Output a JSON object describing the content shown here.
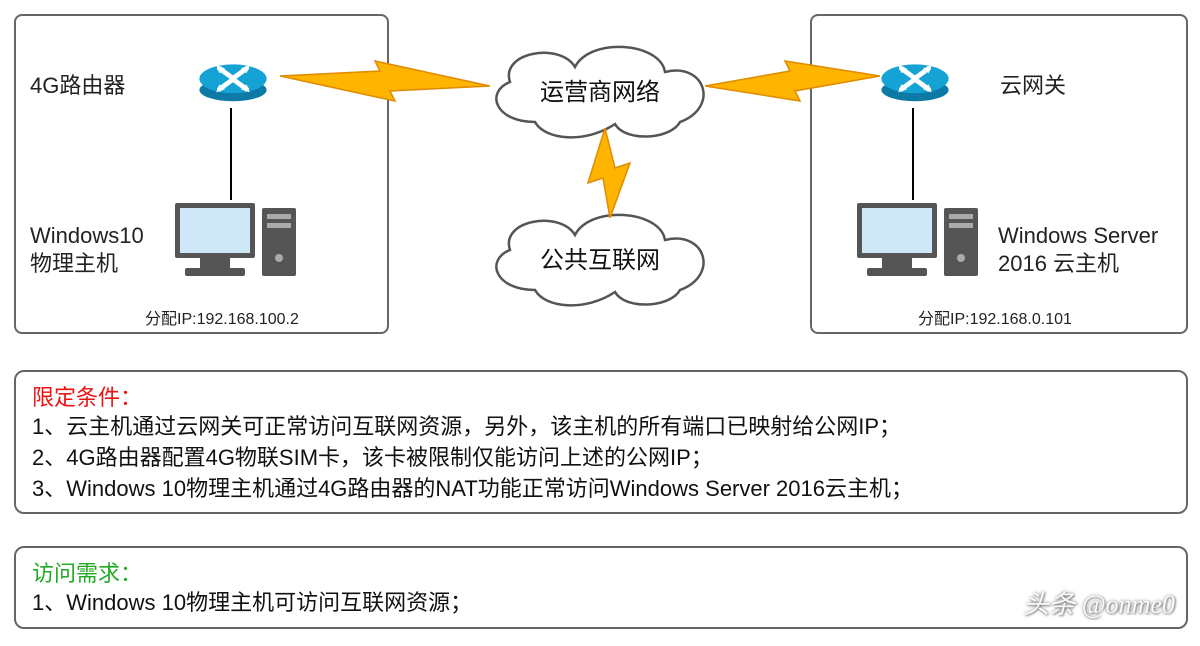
{
  "labels": {
    "router4g": "4G路由器",
    "win10": "Windows10\n物理主机",
    "cloudGateway": "云网关",
    "winServer": "Windows Server\n2016 云主机",
    "ispCloud": "运营商网络",
    "internetCloud": "公共互联网",
    "ip_left": "分配IP:192.168.100.2",
    "ip_right": "分配IP:192.168.0.101"
  },
  "conditions": {
    "title": "限定条件：",
    "l1": "1、云主机通过云网关可正常访问互联网资源，另外，该主机的所有端口已映射给公网IP；",
    "l2": "2、4G路由器配置4G物联SIM卡，该卡被限制仅能访问上述的公网IP；",
    "l3": "3、Windows 10物理主机通过4G路由器的NAT功能正常访问Windows Server 2016云主机；"
  },
  "requirement": {
    "title": "访问需求：",
    "l1": "1、Windows 10物理主机可访问互联网资源；"
  },
  "watermark": "头条 @onme0",
  "colors": {
    "routerBlue": "#15a3d6",
    "routerDark": "#0c7aa4",
    "bolt": "#ffb400",
    "boltStroke": "#e08b00",
    "border": "#666"
  }
}
